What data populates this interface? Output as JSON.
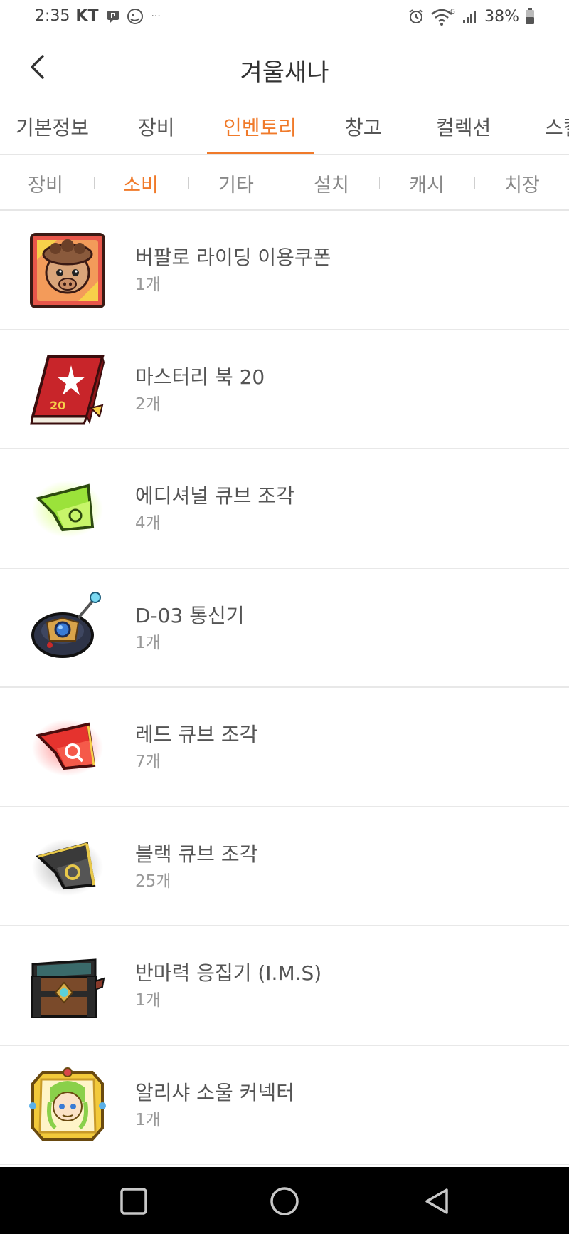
{
  "status_bar": {
    "time": "2:35",
    "carrier": "KT",
    "more": "···",
    "battery": "38%",
    "icons": [
      "notification-icon",
      "app-notification-icon",
      "alarm-icon",
      "wifi-icon",
      "signal-icon",
      "battery-icon"
    ]
  },
  "header": {
    "title": "겨울새나",
    "back_icon": "back-arrow-icon"
  },
  "main_tabs": [
    {
      "label": "기본정보",
      "active": false
    },
    {
      "label": "장비",
      "active": false
    },
    {
      "label": "인벤토리",
      "active": true
    },
    {
      "label": "창고",
      "active": false
    },
    {
      "label": "컬렉션",
      "active": false
    },
    {
      "label": "스킬",
      "active": false
    }
  ],
  "sub_tabs": [
    {
      "label": "장비",
      "active": false
    },
    {
      "label": "소비",
      "active": true
    },
    {
      "label": "기타",
      "active": false
    },
    {
      "label": "설치",
      "active": false
    },
    {
      "label": "캐시",
      "active": false
    },
    {
      "label": "치장",
      "active": false
    }
  ],
  "items": [
    {
      "name": "버팔로 라이딩 이용쿠폰",
      "count": "1개",
      "icon": "buffalo-coupon-icon"
    },
    {
      "name": "마스터리 북 20",
      "count": "2개",
      "icon": "mastery-book-icon"
    },
    {
      "name": "에디셔널 큐브 조각",
      "count": "4개",
      "icon": "additional-cube-fragment-icon"
    },
    {
      "name": "D-03 통신기",
      "count": "1개",
      "icon": "communicator-icon"
    },
    {
      "name": "레드 큐브 조각",
      "count": "7개",
      "icon": "red-cube-fragment-icon"
    },
    {
      "name": "블랙 큐브 조각",
      "count": "25개",
      "icon": "black-cube-fragment-icon"
    },
    {
      "name": "반마력 응집기 (I.M.S)",
      "count": "1개",
      "icon": "treasure-chest-icon"
    },
    {
      "name": "알리샤 소울 커넥터",
      "count": "1개",
      "icon": "soul-connector-icon"
    }
  ],
  "nav_bar": {
    "icons": [
      "recent-apps-icon",
      "home-icon",
      "back-icon"
    ]
  },
  "colors": {
    "accent": "#f07a2a",
    "divider": "#e6e6e6",
    "nav_bg": "#000000"
  }
}
